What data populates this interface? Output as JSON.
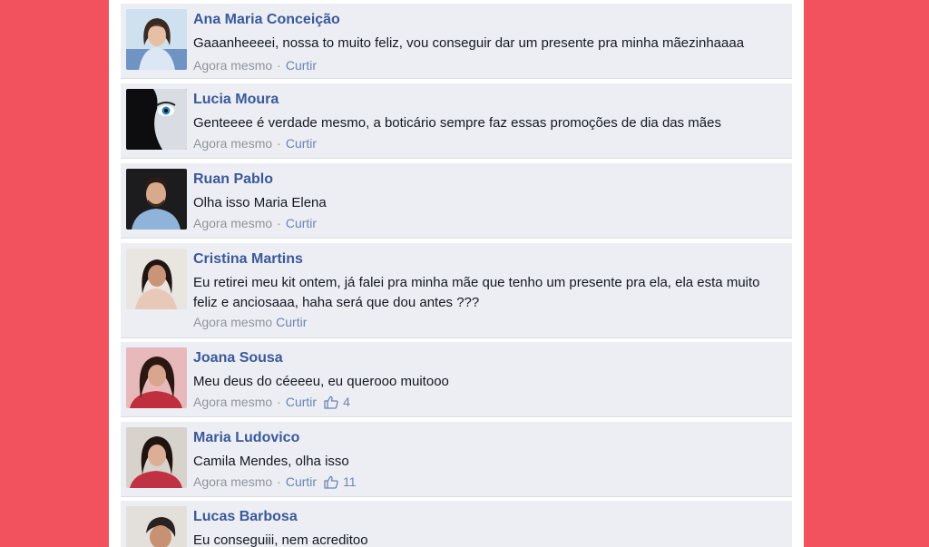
{
  "comments": [
    {
      "author": "Ana Maria Conceição",
      "text": "Gaaanheeeei, nossa to muito feliz, vou conseguir dar um presente pra minha mãezinhaaaa",
      "time": "Agora mesmo",
      "dot": "·",
      "like_label": "Curtir",
      "likes": ""
    },
    {
      "author": "Lucia Moura",
      "text": "Genteeee é verdade mesmo, a boticário sempre faz essas promoções de dia das mães",
      "time": "Agora mesmo",
      "dot": "·",
      "like_label": "Curtir",
      "likes": ""
    },
    {
      "author": "Ruan Pablo",
      "text": "Olha isso Maria Elena",
      "time": "Agora mesmo",
      "dot": "·",
      "like_label": "Curtir",
      "likes": ""
    },
    {
      "author": "Cristina Martins",
      "text": "Eu retirei meu kit ontem, já falei pra minha mãe que tenho um presente pra ela, ela esta muito feliz e anciosaaa, haha será que dou antes ???",
      "time": "Agora mesmo",
      "dot": "",
      "like_label": "Curtir",
      "likes": ""
    },
    {
      "author": "Joana Sousa",
      "text": "Meu deus do céeeeu, eu querooo muitooo",
      "time": "Agora mesmo",
      "dot": "·",
      "like_label": "Curtir",
      "likes": "4"
    },
    {
      "author": "Maria Ludovico",
      "text": "Camila Mendes, olha isso",
      "time": "Agora mesmo",
      "dot": "·",
      "like_label": "Curtir",
      "likes": "11"
    },
    {
      "author": "Lucas Barbosa",
      "text": "Eu conseguiii, nem acreditoo",
      "time": "",
      "dot": "",
      "like_label": "",
      "likes": ""
    }
  ],
  "colors": {
    "background": "#f2515e",
    "name": "#3b5998",
    "link": "#6d84b4",
    "meta": "#90949c"
  }
}
